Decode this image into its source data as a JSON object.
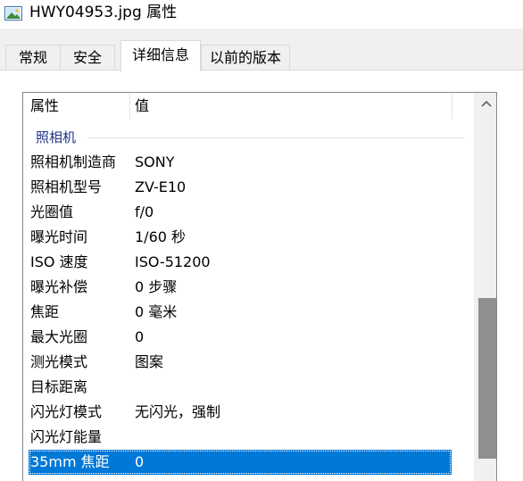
{
  "window": {
    "title": "HWY04953.jpg 属性"
  },
  "tabs": [
    {
      "label": "常规"
    },
    {
      "label": "安全"
    },
    {
      "label": "详细信息"
    },
    {
      "label": "以前的版本"
    }
  ],
  "columns": {
    "name": "属性",
    "value": "值"
  },
  "group": {
    "label": "照相机"
  },
  "rows": [
    {
      "name": "照相机制造商",
      "value": "SONY"
    },
    {
      "name": "照相机型号",
      "value": "ZV-E10"
    },
    {
      "name": "光圈值",
      "value": "f/0"
    },
    {
      "name": "曝光时间",
      "value": "1/60 秒"
    },
    {
      "name": "ISO 速度",
      "value": "ISO-51200"
    },
    {
      "name": "曝光补偿",
      "value": "0 步骤"
    },
    {
      "name": "焦距",
      "value": "0 毫米"
    },
    {
      "name": "最大光圈",
      "value": "0"
    },
    {
      "name": "测光模式",
      "value": "图案"
    },
    {
      "name": "目标距离",
      "value": ""
    },
    {
      "name": "闪光灯模式",
      "value": "无闪光，强制"
    },
    {
      "name": "闪光灯能量",
      "value": ""
    },
    {
      "name": "35mm 焦距",
      "value": "0"
    }
  ],
  "selected_row": "35mm 焦距",
  "colors": {
    "selection": "#0078d7",
    "group_label": "#1e3287"
  }
}
